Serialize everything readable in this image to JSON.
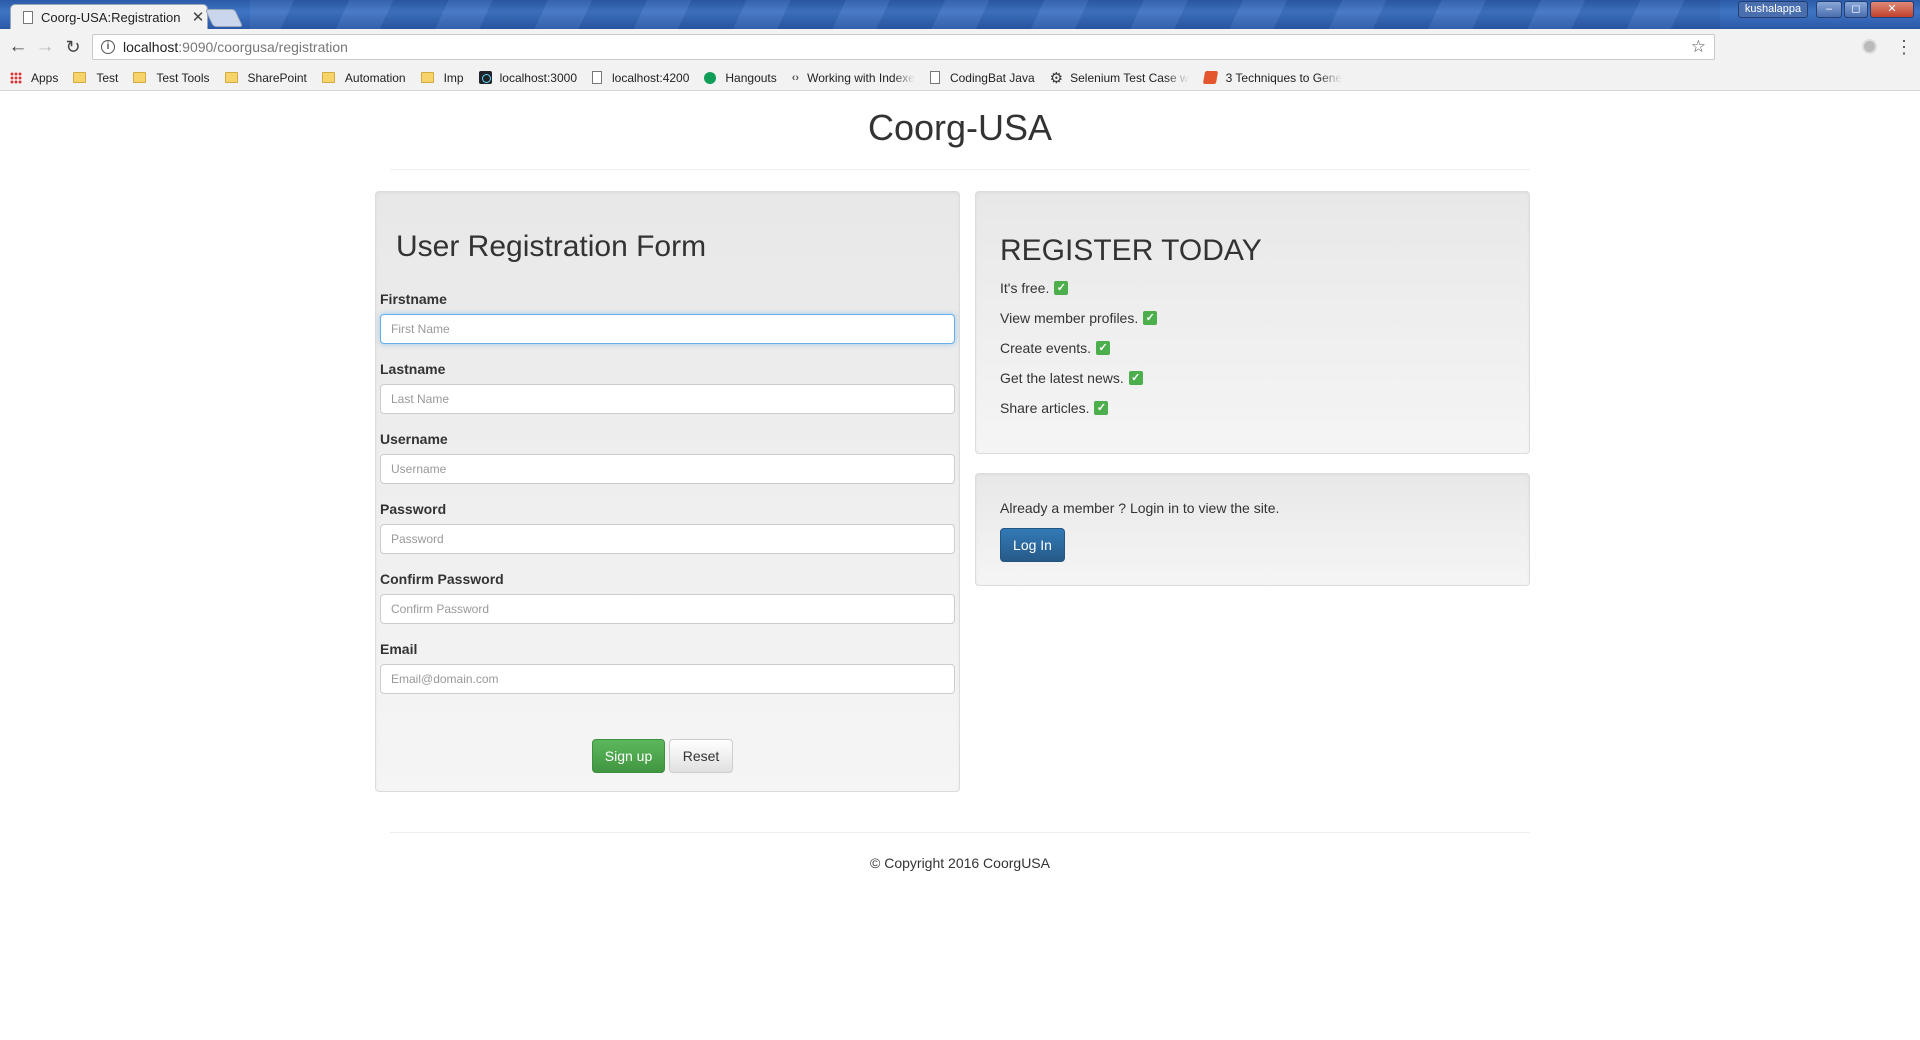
{
  "browser": {
    "tab_title": "Coorg-USA:Registration",
    "tab_close": "✕",
    "user": "kushalappa",
    "url_host": "localhost",
    "url_path": ":9090/coorgusa/registration",
    "bookmarks": [
      {
        "icon": "apps-icon",
        "label": "Apps"
      },
      {
        "icon": "folder-icon",
        "label": "Test"
      },
      {
        "icon": "folder-icon",
        "label": "Test Tools"
      },
      {
        "icon": "folder-icon",
        "label": "SharePoint"
      },
      {
        "icon": "folder-icon",
        "label": "Automation"
      },
      {
        "icon": "folder-icon",
        "label": "Imp"
      },
      {
        "icon": "react-icon",
        "label": "localhost:3000"
      },
      {
        "icon": "doc-icon",
        "label": "localhost:4200"
      },
      {
        "icon": "hangouts-icon",
        "label": "Hangouts"
      },
      {
        "icon": "code-icon",
        "label": "Working with Indexe"
      },
      {
        "icon": "doc-icon",
        "label": "CodingBat Java"
      },
      {
        "icon": "gear-icon",
        "label": "Selenium Test Case w"
      },
      {
        "icon": "bolt-icon",
        "label": "3 Techniques to Gene"
      }
    ]
  },
  "page": {
    "title": "Coorg-USA",
    "footer": "© Copyright 2016 CoorgUSA"
  },
  "form": {
    "heading": "User Registration Form",
    "fields": {
      "firstname": {
        "label": "Firstname",
        "placeholder": "First Name",
        "value": ""
      },
      "lastname": {
        "label": "Lastname",
        "placeholder": "Last Name",
        "value": ""
      },
      "username": {
        "label": "Username",
        "placeholder": "Username",
        "value": ""
      },
      "password": {
        "label": "Password",
        "placeholder": "Password",
        "value": ""
      },
      "confirm_password": {
        "label": "Confirm Password",
        "placeholder": "Confirm Password",
        "value": ""
      },
      "email": {
        "label": "Email",
        "placeholder": "Email@domain.com",
        "value": ""
      }
    },
    "signup_label": "Sign up",
    "reset_label": "Reset"
  },
  "register": {
    "heading": "REGISTER TODAY",
    "benefits": [
      "It's free.",
      "View member profiles.",
      "Create events.",
      "Get the latest news.",
      "Share articles."
    ]
  },
  "login": {
    "text": "Already a member ? Login in to view the site.",
    "button_label": "Log In"
  },
  "colors": {
    "signup": "#5cb85c",
    "login": "#337ab7",
    "check": "#4cae4c"
  }
}
